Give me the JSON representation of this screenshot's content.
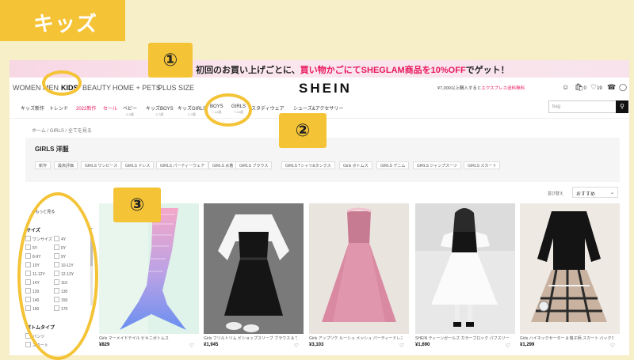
{
  "tag_label": "キッズ",
  "banner": {
    "pre": "初回のお買い上げごとに、",
    "highlight": "買い物かごにてSHEGLAM商品を10%OFF",
    "post": "でゲット！"
  },
  "nav1": [
    "WOMEN",
    "MEN",
    "KIDS",
    "BEAUTY",
    "HOME + PETS",
    "PLUS SIZE"
  ],
  "logo": "SHEIN",
  "promo": {
    "text": "¥7,000以上購入すると",
    "highlight": "エクスプレス送料無料"
  },
  "icons": {
    "wishlist_count": "19",
    "cart_count": "0"
  },
  "nav2": [
    {
      "label": "キッズ新作",
      "sub": ""
    },
    {
      "label": "トレンド",
      "sub": ""
    },
    {
      "label": "2022新作",
      "sub": "",
      "red": true
    },
    {
      "label": "セール",
      "sub": "",
      "red": true
    },
    {
      "label": "ベビー",
      "sub": "0-3歳"
    },
    {
      "label": "キッズBOYS",
      "sub": "2-7歳"
    },
    {
      "label": "キッズGIRLS",
      "sub": "2-7歳"
    },
    {
      "label": "BOYS",
      "sub": "7-14歳"
    },
    {
      "label": "GIRLS",
      "sub": "7-14歳"
    },
    {
      "label": "スタディウェア",
      "sub": ""
    },
    {
      "label": "シューズ&アクセサリー",
      "sub": ""
    }
  ],
  "search": {
    "placeholder": "bag"
  },
  "breadcrumb": "ホーム / GIRLS / 全てを見る",
  "panel_title": "GIRLS 洋服",
  "chips": [
    "新作",
    "最高評価",
    "GIRLS ワンピース",
    "GIRLS ドレス",
    "GIRLS パーティーウェア",
    "GIRLS 水着",
    "GIRLS ブラウス",
    "GIRLS Tシャツ&タンクス",
    "Girls ボトムス",
    "GIRLS デニム",
    "GIRLS ジャンプスーツ",
    "GIRLS スカート"
  ],
  "sort": {
    "label": "並び替え",
    "value": "おすすめ"
  },
  "sidebar": {
    "back": "< もっと見る",
    "size_title": "サイズ",
    "sizes": [
      "ワンサイズ",
      "4Y",
      "5Y",
      "6Y",
      "8-9Y",
      "9Y",
      "10Y",
      "10-11Y",
      "11-12Y",
      "12-13Y",
      "14Y",
      "110",
      "120",
      "130",
      "140",
      "150",
      "160",
      "170"
    ],
    "type_title": "ボトムタイプ",
    "types": [
      "パンツ",
      "スカート"
    ]
  },
  "products": [
    {
      "name": "Girls マーメイドテイル ビキニボトムス",
      "price": "¥829"
    },
    {
      "name": "Girls フリルトリム ビショップスリーブ ブラウス & ワンピース",
      "price": "¥1,945"
    },
    {
      "name": "Girls アップリケ ルーシュ メッシュ パーティードレス",
      "price": "¥3,103"
    },
    {
      "name": "SHEIN ティーンガールズ カラーブロック パフスリーブ",
      "price": "¥1,690"
    },
    {
      "name": "Girls ハイネックセーター & 格子柄 スカート バックなし",
      "price": "¥1,299"
    }
  ],
  "annotations": [
    "①",
    "②",
    "③"
  ]
}
